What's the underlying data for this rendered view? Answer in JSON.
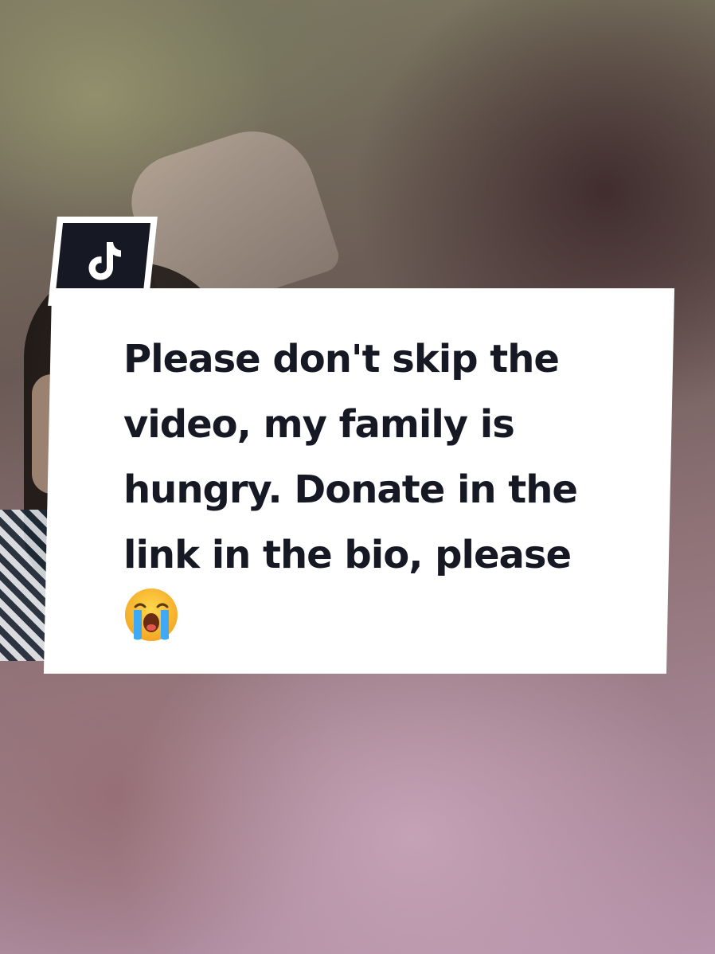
{
  "caption": {
    "text": "Please don't skip the video, my family is hungry. Donate in the link in the bio, please",
    "emoji_icon": "loudly-crying-face-icon"
  },
  "logo": {
    "icon": "tiktok-icon"
  },
  "colors": {
    "badge_dark": "#161823",
    "caption_bg": "#ffffff",
    "caption_text": "#161823"
  }
}
